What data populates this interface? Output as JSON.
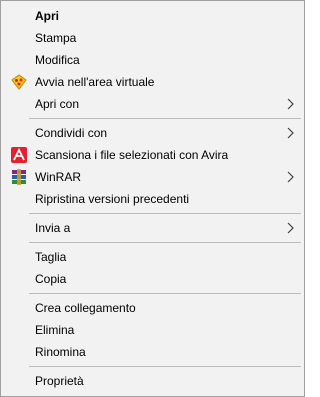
{
  "menu": {
    "open": "Apri",
    "print": "Stampa",
    "edit": "Modifica",
    "sandbox": "Avvia nell'area virtuale",
    "open_with": "Apri con",
    "share_with": "Condividi con",
    "avira_scan": "Scansiona i file selezionati con Avira",
    "winrar": "WinRAR",
    "restore_versions": "Ripristina versioni precedenti",
    "send_to": "Invia a",
    "cut": "Taglia",
    "copy": "Copia",
    "create_shortcut": "Crea collegamento",
    "delete": "Elimina",
    "rename": "Rinomina",
    "properties": "Proprietà"
  },
  "icons": {
    "sandbox": "sandboxie-icon",
    "avira": "avira-icon",
    "winrar": "winrar-icon",
    "submenu": "chevron-right-icon"
  },
  "colors": {
    "menu_background": "#f2f2f2",
    "separator": "#bcbcbc",
    "border": "#a0a0a0",
    "avira_red": "#e4202e",
    "sandbox_yellow": "#f7c919"
  }
}
